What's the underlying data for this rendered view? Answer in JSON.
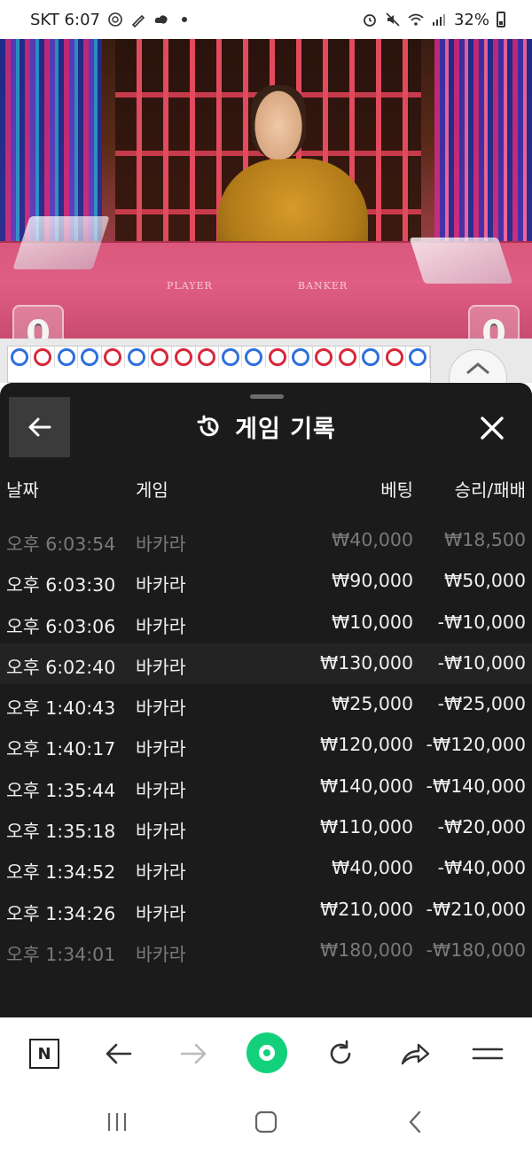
{
  "status_bar": {
    "carrier_time": "SKT 6:07",
    "battery": "32%"
  },
  "video": {
    "player_label": "PLAYER",
    "banker_label": "BANKER",
    "player_score": "0",
    "banker_score": "0"
  },
  "roadmap": {
    "rings": [
      "b",
      "r",
      "b",
      "b",
      "r",
      "b",
      "r",
      "r",
      "r",
      "b",
      "b",
      "r",
      "b",
      "r",
      "r",
      "b",
      "r",
      "b"
    ]
  },
  "sheet": {
    "title": "게임 기록",
    "columns": {
      "date": "날짜",
      "game": "게임",
      "bet": "베팅",
      "result": "승리/패배"
    },
    "rows": [
      {
        "date": "오후 6:03:54",
        "game": "바카라",
        "bet": "₩40,000",
        "result": "₩18,500"
      },
      {
        "date": "오후 6:03:30",
        "game": "바카라",
        "bet": "₩90,000",
        "result": "₩50,000"
      },
      {
        "date": "오후 6:03:06",
        "game": "바카라",
        "bet": "₩10,000",
        "result": "-₩10,000"
      },
      {
        "date": "오후 6:02:40",
        "game": "바카라",
        "bet": "₩130,000",
        "result": "-₩10,000"
      },
      {
        "date": "오후 1:40:43",
        "game": "바카라",
        "bet": "₩25,000",
        "result": "-₩25,000"
      },
      {
        "date": "오후 1:40:17",
        "game": "바카라",
        "bet": "₩120,000",
        "result": "-₩120,000"
      },
      {
        "date": "오후 1:35:44",
        "game": "바카라",
        "bet": "₩140,000",
        "result": "-₩140,000"
      },
      {
        "date": "오후 1:35:18",
        "game": "바카라",
        "bet": "₩110,000",
        "result": "-₩20,000"
      },
      {
        "date": "오후 1:34:52",
        "game": "바카라",
        "bet": "₩40,000",
        "result": "-₩40,000"
      },
      {
        "date": "오후 1:34:26",
        "game": "바카라",
        "bet": "₩210,000",
        "result": "-₩210,000"
      },
      {
        "date": "오후 1:34:01",
        "game": "바카라",
        "bet": "₩180,000",
        "result": "-₩180,000"
      }
    ]
  },
  "toolbar": {
    "naver_label": "N"
  },
  "icons": {
    "back": "arrow-left-icon",
    "history": "history-icon",
    "close": "close-icon",
    "forward": "arrow-right-icon",
    "refresh": "refresh-icon",
    "share": "share-icon",
    "menu": "menu-icon"
  },
  "colors": {
    "sheet_bg": "#1b1b1b",
    "accent_green": "#13d17b",
    "banker_red": "#d8273a",
    "player_blue": "#2f6fde"
  }
}
